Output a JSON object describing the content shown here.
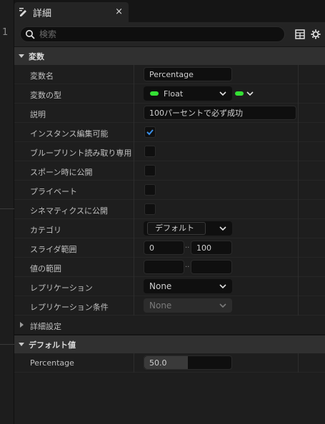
{
  "tab": {
    "title": "詳細",
    "close": "×"
  },
  "search": {
    "placeholder": "検索"
  },
  "sections": {
    "variable": "変数",
    "advanced": "詳細設定",
    "default_value": "デフォルト値"
  },
  "props": {
    "var_name": {
      "label": "変数名",
      "value": "Percentage"
    },
    "var_type": {
      "label": "変数の型",
      "value": "Float"
    },
    "description": {
      "label": "説明",
      "value": "100パーセントで必ず成功"
    },
    "instance_editable": {
      "label": "インスタンス編集可能",
      "checked": true
    },
    "blueprint_readonly": {
      "label": "ブループリント読み取り専用",
      "checked": false
    },
    "expose_on_spawn": {
      "label": "スポーン時に公開",
      "checked": false
    },
    "private": {
      "label": "プライベート",
      "checked": false
    },
    "expose_to_cinematics": {
      "label": "シネマティクスに公開",
      "checked": false
    },
    "category": {
      "label": "カテゴリ",
      "value": "デフォルト"
    },
    "slider_range": {
      "label": "スライダ範囲",
      "min": "0",
      "max": "100",
      "sep": ".."
    },
    "value_range": {
      "label": "値の範囲",
      "min": "",
      "max": "",
      "sep": ".."
    },
    "replication": {
      "label": "レプリケーション",
      "value": "None"
    },
    "replication_condition": {
      "label": "レプリケーション条件",
      "value": "None"
    },
    "percentage": {
      "label": "Percentage",
      "value": "50.0",
      "fill": 0.5
    }
  },
  "colors": {
    "float_pin": "#34e034",
    "check": "#3a8ee6"
  },
  "icons": [
    "edit-icon",
    "search-icon",
    "table-icon",
    "settings-gear-icon",
    "chevron-down-icon",
    "checkmark-icon",
    "collapse-arrow-icon",
    "expand-arrow-icon"
  ]
}
